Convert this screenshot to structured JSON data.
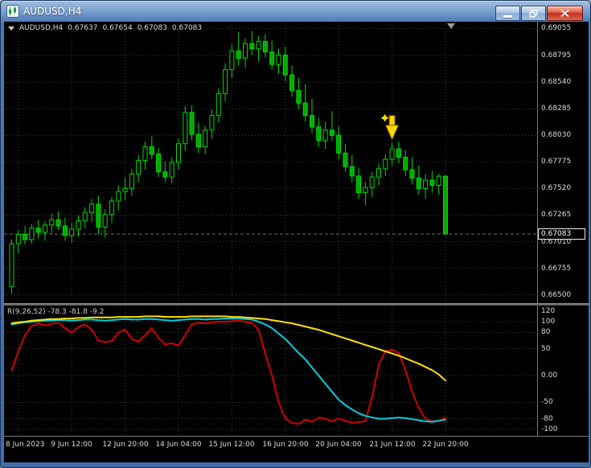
{
  "window": {
    "title": "AUDUSD,H4"
  },
  "chart": {
    "ohlc_line": {
      "symbol": "AUDUSD,H4",
      "open": "0.67637",
      "high": "0.67654",
      "low": "0.67083",
      "close": "0.67083"
    },
    "price_axis_labels": [
      "0.69055",
      "0.68795",
      "0.68540",
      "0.68285",
      "0.68030",
      "0.67775",
      "0.67520",
      "0.67265",
      "0.67010",
      "0.66755",
      "0.66500"
    ],
    "current_price_label": "0.67083"
  },
  "indicator": {
    "label": "R(9,26,52) -78.3 -81.8 -9.2",
    "scale_labels": [
      "120",
      "100",
      "80",
      "50",
      "0.00",
      "-50",
      "-80",
      "-100"
    ]
  },
  "colors": {
    "bg": "#000000",
    "grid": "#404040",
    "candle_stroke": "#00dd00",
    "bull": "#000000",
    "bear": "#00aa00",
    "arrow": "#ffd700",
    "red_line": "#d40000",
    "cyan_line": "#00cfe0",
    "yellow_line": "#ffe100"
  },
  "chart_data": [
    {
      "type": "candlestick",
      "symbol": "AUDUSD",
      "timeframe": "H4",
      "ylim": [
        0.6642,
        0.6912
      ],
      "price_gridlines": [
        0.69055,
        0.68795,
        0.6854,
        0.68285,
        0.6803,
        0.67775,
        0.6752,
        0.67265,
        0.6701,
        0.66755,
        0.665
      ],
      "current_price": 0.67083,
      "time_ticks": {
        "indices": [
          1,
          9,
          17,
          25,
          33,
          41,
          49,
          57,
          65
        ],
        "labels": [
          "8 Jun 2023",
          "9 Jun 12:00",
          "12 Jun 20:00",
          "14 Jun 04:00",
          "15 Jun 12:00",
          "16 Jun 20:00",
          "20 Jun 04:00",
          "21 Jun 12:00",
          "22 Jun 20:00"
        ]
      },
      "candles": [
        [
          0.6658,
          0.6703,
          0.6651,
          0.6699
        ],
        [
          0.6699,
          0.6712,
          0.669,
          0.6708
        ],
        [
          0.6708,
          0.6716,
          0.6698,
          0.6703
        ],
        [
          0.6703,
          0.6718,
          0.6699,
          0.6714
        ],
        [
          0.6714,
          0.6722,
          0.6704,
          0.671
        ],
        [
          0.671,
          0.6721,
          0.6702,
          0.6717
        ],
        [
          0.6717,
          0.6728,
          0.6709,
          0.6722
        ],
        [
          0.6722,
          0.673,
          0.6712,
          0.6716
        ],
        [
          0.6716,
          0.6724,
          0.6702,
          0.6707
        ],
        [
          0.6707,
          0.6719,
          0.67,
          0.6713
        ],
        [
          0.6713,
          0.6726,
          0.6706,
          0.6721
        ],
        [
          0.6721,
          0.6734,
          0.6714,
          0.6729
        ],
        [
          0.6729,
          0.6742,
          0.672,
          0.6737
        ],
        [
          0.6737,
          0.6745,
          0.6708,
          0.6715
        ],
        [
          0.6715,
          0.6732,
          0.6705,
          0.6727
        ],
        [
          0.6727,
          0.6744,
          0.6719,
          0.674
        ],
        [
          0.674,
          0.6755,
          0.6731,
          0.6749
        ],
        [
          0.6749,
          0.6762,
          0.6741,
          0.6752
        ],
        [
          0.6752,
          0.6771,
          0.6745,
          0.6766
        ],
        [
          0.6766,
          0.6784,
          0.6758,
          0.6779
        ],
        [
          0.6779,
          0.6797,
          0.677,
          0.6792
        ],
        [
          0.6792,
          0.6802,
          0.678,
          0.6785
        ],
        [
          0.6785,
          0.6791,
          0.6763,
          0.6768
        ],
        [
          0.6768,
          0.6778,
          0.6758,
          0.6763
        ],
        [
          0.6763,
          0.6782,
          0.6757,
          0.6777
        ],
        [
          0.6777,
          0.68,
          0.677,
          0.6795
        ],
        [
          0.6795,
          0.6831,
          0.6788,
          0.6825
        ],
        [
          0.6825,
          0.6832,
          0.6798,
          0.6804
        ],
        [
          0.6804,
          0.6815,
          0.6786,
          0.6792
        ],
        [
          0.6792,
          0.6812,
          0.6785,
          0.6808
        ],
        [
          0.6808,
          0.6828,
          0.68,
          0.6822
        ],
        [
          0.6822,
          0.6848,
          0.6815,
          0.6843
        ],
        [
          0.6843,
          0.6872,
          0.6836,
          0.6866
        ],
        [
          0.6866,
          0.689,
          0.6858,
          0.6884
        ],
        [
          0.6884,
          0.6902,
          0.687,
          0.6877
        ],
        [
          0.6877,
          0.6896,
          0.6868,
          0.6891
        ],
        [
          0.6891,
          0.6903,
          0.688,
          0.6886
        ],
        [
          0.6886,
          0.6898,
          0.6874,
          0.6893
        ],
        [
          0.6893,
          0.69,
          0.6878,
          0.6883
        ],
        [
          0.6883,
          0.6894,
          0.6866,
          0.6871
        ],
        [
          0.6871,
          0.6886,
          0.6862,
          0.688
        ],
        [
          0.688,
          0.6888,
          0.6855,
          0.6861
        ],
        [
          0.6861,
          0.687,
          0.684,
          0.6846
        ],
        [
          0.6846,
          0.6858,
          0.6828,
          0.6834
        ],
        [
          0.6834,
          0.6852,
          0.6816,
          0.6822
        ],
        [
          0.6822,
          0.6838,
          0.6805,
          0.6811
        ],
        [
          0.6811,
          0.682,
          0.6792,
          0.6798
        ],
        [
          0.6798,
          0.6816,
          0.679,
          0.6808
        ],
        [
          0.6808,
          0.6826,
          0.6798,
          0.6803
        ],
        [
          0.6803,
          0.6812,
          0.678,
          0.6786
        ],
        [
          0.6786,
          0.6795,
          0.6768,
          0.6773
        ],
        [
          0.6773,
          0.6784,
          0.6758,
          0.6764
        ],
        [
          0.6764,
          0.6772,
          0.6742,
          0.6748
        ],
        [
          0.6748,
          0.6758,
          0.6736,
          0.6753
        ],
        [
          0.6753,
          0.6768,
          0.6744,
          0.6763
        ],
        [
          0.6763,
          0.6776,
          0.6755,
          0.6771
        ],
        [
          0.6771,
          0.6785,
          0.6764,
          0.678
        ],
        [
          0.678,
          0.6796,
          0.6774,
          0.679
        ],
        [
          0.679,
          0.6797,
          0.6776,
          0.6782
        ],
        [
          0.6782,
          0.6789,
          0.6764,
          0.677
        ],
        [
          0.677,
          0.6782,
          0.6756,
          0.6762
        ],
        [
          0.6762,
          0.6774,
          0.6746,
          0.6752
        ],
        [
          0.6752,
          0.6766,
          0.6742,
          0.676
        ],
        [
          0.676,
          0.6769,
          0.6748,
          0.6755
        ],
        [
          0.6755,
          0.6766,
          0.6746,
          0.67637
        ],
        [
          0.67637,
          0.67654,
          0.67083,
          0.67083
        ]
      ],
      "annotations": [
        {
          "type": "down-arrow",
          "index": 57,
          "price": 0.6822,
          "color": "#ffd700"
        }
      ]
    },
    {
      "type": "line",
      "name": "R(9,26,52)",
      "current_values": [
        -78.3,
        -81.8,
        -9.2
      ],
      "ylim": [
        -112,
        130
      ],
      "levels": [
        100,
        80,
        50,
        0,
        -50,
        -80,
        -100
      ],
      "scale_values": [
        120,
        100,
        80,
        50,
        0,
        -50,
        -80,
        -100
      ],
      "series": [
        {
          "name": "R9",
          "color": "#d40000",
          "values": [
            10,
            45,
            75,
            92,
            97,
            93,
            96,
            98,
            88,
            80,
            90,
            95,
            85,
            65,
            62,
            64,
            80,
            85,
            68,
            63,
            75,
            88,
            70,
            58,
            60,
            56,
            75,
            95,
            98,
            97,
            99,
            100,
            100,
            101,
            102,
            100,
            98,
            85,
            40,
            0,
            -50,
            -80,
            -88,
            -90,
            -82,
            -86,
            -78,
            -80,
            -85,
            -80,
            -84,
            -88,
            -86,
            -85,
            -40,
            20,
            45,
            48,
            42,
            10,
            -30,
            -60,
            -80,
            -85,
            -84,
            -78.3
          ]
        },
        {
          "name": "R26",
          "color": "#00cfe0",
          "values": [
            95,
            97,
            99,
            100,
            101,
            102,
            102,
            103,
            103,
            102,
            103,
            104,
            104,
            103,
            102,
            103,
            104,
            105,
            104,
            104,
            105,
            105,
            104,
            103,
            102,
            103,
            104,
            105,
            105,
            104,
            105,
            105,
            106,
            106,
            106,
            105,
            104,
            100,
            95,
            88,
            78,
            68,
            55,
            42,
            30,
            15,
            0,
            -15,
            -30,
            -45,
            -55,
            -63,
            -70,
            -75,
            -78,
            -80,
            -80,
            -79,
            -78,
            -79,
            -81,
            -83,
            -85,
            -86,
            -84,
            -81.8
          ]
        },
        {
          "name": "R52",
          "color": "#ffe100",
          "values": [
            97,
            99,
            100,
            102,
            103,
            104,
            105,
            105,
            106,
            106,
            107,
            107,
            108,
            108,
            108,
            108,
            109,
            109,
            109,
            109,
            110,
            110,
            110,
            109,
            109,
            109,
            109,
            110,
            110,
            110,
            110,
            110,
            110,
            109,
            109,
            108,
            107,
            106,
            105,
            103,
            101,
            99,
            97,
            94,
            91,
            88,
            85,
            81,
            77,
            73,
            69,
            65,
            61,
            57,
            53,
            49,
            45,
            41,
            37,
            32,
            27,
            22,
            16,
            10,
            2,
            -9.2
          ]
        }
      ]
    }
  ]
}
